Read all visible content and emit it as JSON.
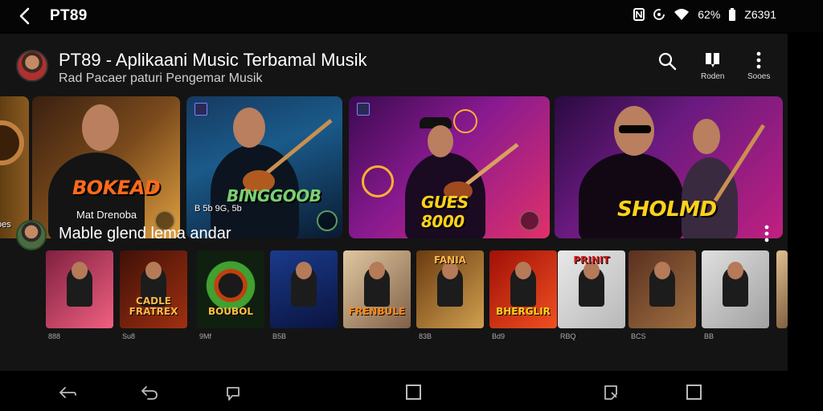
{
  "status_bar": {
    "title": "PT89",
    "battery": "62%",
    "time": "Z6391",
    "icons": [
      "nfc-icon",
      "data-saver-icon",
      "wifi-icon",
      "battery-icon"
    ]
  },
  "header": {
    "title": "PT89 - Aplikaani Music Terbamal Musik",
    "subtitle": "Rad Pacaer paturi Pengemar Musik",
    "actions": [
      {
        "icon": "search-icon",
        "label": ""
      },
      {
        "icon": "library-icon",
        "label": "Roden"
      },
      {
        "icon": "more-vert-icon",
        "label": "Sooes"
      }
    ]
  },
  "featured": [
    {
      "title": "",
      "subtitle": "oes"
    },
    {
      "title": "BOKEAD",
      "subtitle": "Mat Drenoba"
    },
    {
      "title": "BINGGOOB",
      "subtitle": "B 5b 9G, 5b"
    },
    {
      "title": "GUES 8000",
      "subtitle": ""
    },
    {
      "title": "SHOLMD",
      "subtitle": ""
    }
  ],
  "section": {
    "title": "Mable glend lema andar",
    "albums": [
      {
        "title": "",
        "meta": "888"
      },
      {
        "title": "CADLE FRATREX",
        "meta": "Su8"
      },
      {
        "title": "BOUBOL",
        "meta": "9Mf"
      },
      {
        "title": "",
        "meta": "B5B"
      },
      {
        "title": "FRENBULE",
        "meta": ""
      },
      {
        "title": "FANIA",
        "meta": "83B"
      },
      {
        "title": "BHERGLIR",
        "meta": "Bd9"
      },
      {
        "title": "PRINIT",
        "meta": "RBQ"
      },
      {
        "title": "",
        "meta": "BCS"
      },
      {
        "title": "",
        "meta": "BB"
      }
    ]
  },
  "nav": [
    "back-icon",
    "undo-icon",
    "share-icon",
    "home-square-icon",
    "bookmark-icon",
    "recents-square-icon"
  ],
  "colors": {
    "background": "#141414",
    "accent_orange": "#ff8a1a",
    "accent_yellow": "#ffd21a"
  }
}
